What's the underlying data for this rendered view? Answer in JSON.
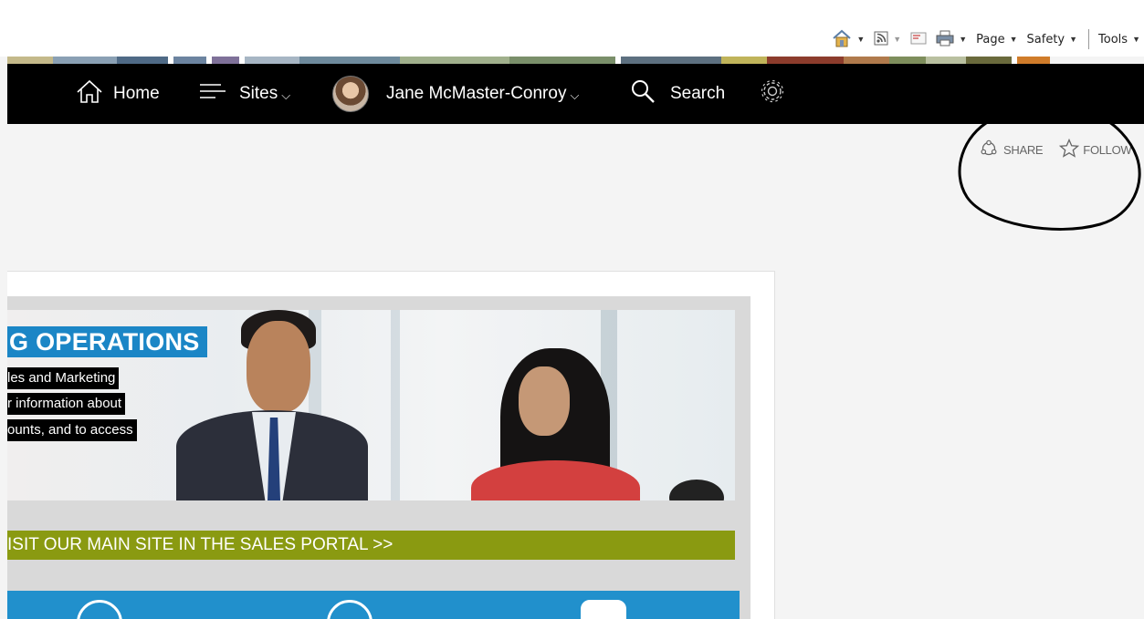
{
  "ie_toolbar": {
    "home_icon": "home-icon",
    "feeds_icon": "rss-icon",
    "mail_icon": "mail-icon",
    "print_icon": "print-icon",
    "page_label": "Page",
    "safety_label": "Safety",
    "tools_label": "Tools"
  },
  "nav": {
    "home_label": "Home",
    "sites_label": "Sites",
    "user_name": "Jane McMaster-Conroy",
    "search_label": "Search"
  },
  "actions": {
    "share_label": "SHARE",
    "follow_label": "FOLLOW"
  },
  "banner": {
    "title": "G OPERATIONS",
    "line1": "les and Marketing",
    "line2": "r information about",
    "line3": "ounts, and to access"
  },
  "cta": {
    "label": "ISIT OUR MAIN SITE IN THE SALES PORTAL >>"
  },
  "colors": {
    "nav_bg": "#000000",
    "banner_title_bg": "#1b86c6",
    "cta_bg": "#8a9a11",
    "tiles_bg": "#2190cc"
  }
}
